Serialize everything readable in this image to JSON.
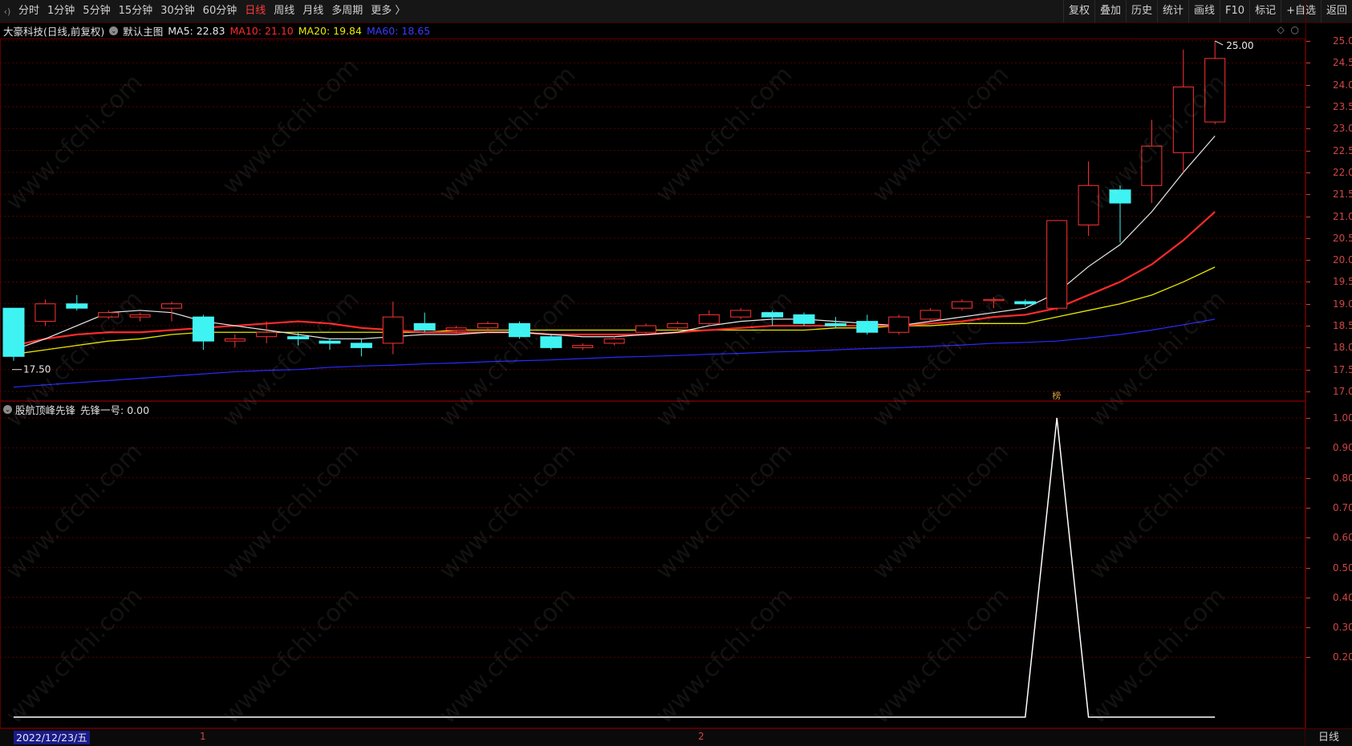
{
  "toolbar": {
    "logo": "‹)",
    "periods": [
      "分时",
      "1分钟",
      "5分钟",
      "15分钟",
      "30分钟",
      "60分钟",
      "日线",
      "周线",
      "月线",
      "多周期",
      "更多 〉"
    ],
    "active_period": "日线",
    "right_buttons": [
      "复权",
      "叠加",
      "历史",
      "统计",
      "画线",
      "F10",
      "标记",
      "+自选",
      "返回"
    ]
  },
  "main_chart": {
    "title": "大豪科技(日线,前复权)",
    "template": "默认主图",
    "ma5": "MA5: 22.83",
    "ma10": "MA10: 21.10",
    "ma20": "MA20: 19.84",
    "ma60": "MA60: 18.65",
    "high_label": "25.00",
    "low_label": "17.50",
    "marker": "榜",
    "colors": {
      "ma5": "#e8e8e8",
      "ma10": "#ff2a2a",
      "ma20": "#e8e800",
      "ma60": "#2a2aff",
      "up": "#ff3333",
      "down": "#3ff3f3"
    }
  },
  "indicator": {
    "name": "股航顶峰先锋",
    "series_label": "先锋一号: 0.00"
  },
  "bottom": {
    "date": "2022/12/23/五",
    "marker1": "1",
    "marker2": "2",
    "period": "日线"
  },
  "watermark": "www.cfchi.com",
  "chart_data": {
    "type": "candlestick",
    "price_axis": {
      "ylim": [
        17.0,
        25.0
      ],
      "ticks": [
        "17.00",
        "17.50",
        "18.00",
        "18.50",
        "19.00",
        "19.50",
        "20.00",
        "20.50",
        "21.00",
        "21.50",
        "22.00",
        "22.50",
        "23.00",
        "23.50",
        "24.00",
        "24.50",
        "25.00"
      ]
    },
    "candles": [
      {
        "o": 18.9,
        "c": 17.8,
        "h": 18.9,
        "l": 17.7
      },
      {
        "o": 18.6,
        "c": 19.0,
        "h": 19.1,
        "l": 18.5
      },
      {
        "o": 19.0,
        "c": 18.9,
        "h": 19.2,
        "l": 18.85
      },
      {
        "o": 18.7,
        "c": 18.8,
        "h": 18.85,
        "l": 18.65
      },
      {
        "o": 18.7,
        "c": 18.75,
        "h": 18.8,
        "l": 18.6
      },
      {
        "o": 18.9,
        "c": 19.0,
        "h": 19.05,
        "l": 18.6
      },
      {
        "o": 18.7,
        "c": 18.15,
        "h": 18.75,
        "l": 17.95
      },
      {
        "o": 18.15,
        "c": 18.2,
        "h": 18.3,
        "l": 18.0
      },
      {
        "o": 18.25,
        "c": 18.35,
        "h": 18.6,
        "l": 18.1
      },
      {
        "o": 18.25,
        "c": 18.2,
        "h": 18.35,
        "l": 18.05
      },
      {
        "o": 18.15,
        "c": 18.1,
        "h": 18.2,
        "l": 17.95
      },
      {
        "o": 18.1,
        "c": 18.0,
        "h": 18.2,
        "l": 17.8
      },
      {
        "o": 18.1,
        "c": 18.7,
        "h": 19.05,
        "l": 17.85
      },
      {
        "o": 18.55,
        "c": 18.4,
        "h": 18.8,
        "l": 18.35
      },
      {
        "o": 18.4,
        "c": 18.45,
        "h": 18.5,
        "l": 18.3
      },
      {
        "o": 18.45,
        "c": 18.55,
        "h": 18.6,
        "l": 18.35
      },
      {
        "o": 18.55,
        "c": 18.25,
        "h": 18.6,
        "l": 18.2
      },
      {
        "o": 18.25,
        "c": 18.0,
        "h": 18.3,
        "l": 17.95
      },
      {
        "o": 18.0,
        "c": 18.05,
        "h": 18.1,
        "l": 17.95
      },
      {
        "o": 18.1,
        "c": 18.2,
        "h": 18.25,
        "l": 18.05
      },
      {
        "o": 18.35,
        "c": 18.5,
        "h": 18.55,
        "l": 18.3
      },
      {
        "o": 18.45,
        "c": 18.55,
        "h": 18.6,
        "l": 18.4
      },
      {
        "o": 18.55,
        "c": 18.75,
        "h": 18.85,
        "l": 18.5
      },
      {
        "o": 18.7,
        "c": 18.85,
        "h": 18.9,
        "l": 18.65
      },
      {
        "o": 18.8,
        "c": 18.7,
        "h": 18.85,
        "l": 18.5
      },
      {
        "o": 18.75,
        "c": 18.55,
        "h": 18.8,
        "l": 18.5
      },
      {
        "o": 18.55,
        "c": 18.5,
        "h": 18.7,
        "l": 18.45
      },
      {
        "o": 18.6,
        "c": 18.35,
        "h": 18.75,
        "l": 18.3
      },
      {
        "o": 18.35,
        "c": 18.7,
        "h": 18.75,
        "l": 18.3
      },
      {
        "o": 18.65,
        "c": 18.85,
        "h": 18.9,
        "l": 18.6
      },
      {
        "o": 18.9,
        "c": 19.05,
        "h": 19.1,
        "l": 18.85
      },
      {
        "o": 19.1,
        "c": 19.1,
        "h": 19.15,
        "l": 18.9
      },
      {
        "o": 19.05,
        "c": 19.0,
        "h": 19.1,
        "l": 18.95
      },
      {
        "o": 18.9,
        "c": 20.9,
        "h": 20.9,
        "l": 18.85
      },
      {
        "o": 20.8,
        "c": 21.7,
        "h": 22.25,
        "l": 20.55
      },
      {
        "o": 21.6,
        "c": 21.3,
        "h": 21.7,
        "l": 20.4
      },
      {
        "o": 21.7,
        "c": 22.6,
        "h": 23.2,
        "l": 21.3
      },
      {
        "o": 22.45,
        "c": 23.95,
        "h": 24.8,
        "l": 22.0
      },
      {
        "o": 23.15,
        "c": 24.6,
        "h": 25.0,
        "l": 23.1
      }
    ],
    "ma5": [
      17.95,
      18.2,
      18.5,
      18.8,
      18.85,
      18.8,
      18.6,
      18.5,
      18.4,
      18.3,
      18.2,
      18.2,
      18.25,
      18.3,
      18.3,
      18.35,
      18.35,
      18.3,
      18.25,
      18.25,
      18.3,
      18.35,
      18.5,
      18.6,
      18.65,
      18.65,
      18.6,
      18.55,
      18.5,
      18.6,
      18.7,
      18.8,
      18.9,
      19.25,
      19.85,
      20.35,
      21.1,
      22.0,
      22.83
    ],
    "ma10": [
      18.05,
      18.2,
      18.3,
      18.35,
      18.35,
      18.4,
      18.45,
      18.5,
      18.55,
      18.6,
      18.55,
      18.45,
      18.4,
      18.35,
      18.35,
      18.35,
      18.35,
      18.3,
      18.3,
      18.3,
      18.3,
      18.35,
      18.4,
      18.45,
      18.5,
      18.5,
      18.5,
      18.5,
      18.5,
      18.55,
      18.6,
      18.7,
      18.75,
      18.9,
      19.2,
      19.5,
      19.9,
      20.45,
      21.1
    ],
    "ma20": [
      17.85,
      17.95,
      18.05,
      18.15,
      18.2,
      18.3,
      18.35,
      18.35,
      18.35,
      18.35,
      18.35,
      18.35,
      18.35,
      18.35,
      18.4,
      18.4,
      18.4,
      18.4,
      18.4,
      18.4,
      18.4,
      18.4,
      18.4,
      18.4,
      18.4,
      18.4,
      18.45,
      18.45,
      18.5,
      18.5,
      18.55,
      18.55,
      18.55,
      18.7,
      18.85,
      19.0,
      19.2,
      19.5,
      19.84
    ],
    "ma60": [
      17.1,
      17.15,
      17.2,
      17.25,
      17.3,
      17.35,
      17.4,
      17.45,
      17.48,
      17.5,
      17.55,
      17.58,
      17.6,
      17.63,
      17.65,
      17.68,
      17.7,
      17.72,
      17.75,
      17.78,
      17.8,
      17.82,
      17.85,
      17.87,
      17.9,
      17.92,
      17.95,
      17.98,
      18.0,
      18.03,
      18.06,
      18.1,
      18.12,
      18.15,
      18.22,
      18.3,
      18.4,
      18.52,
      18.65
    ],
    "indicator_axis": {
      "ylim": [
        0,
        1.05
      ],
      "ticks": [
        "0.20",
        "0.30",
        "0.40",
        "0.50",
        "0.60",
        "0.70",
        "0.80",
        "0.90",
        "1.00"
      ]
    },
    "indicator_values": [
      0,
      0,
      0,
      0,
      0,
      0,
      0,
      0,
      0,
      0,
      0,
      0,
      0,
      0,
      0,
      0,
      0,
      0,
      0,
      0,
      0,
      0,
      0,
      0,
      0,
      0,
      0,
      0,
      0,
      0,
      0,
      0,
      0,
      1,
      0,
      0,
      0,
      0,
      0
    ]
  }
}
